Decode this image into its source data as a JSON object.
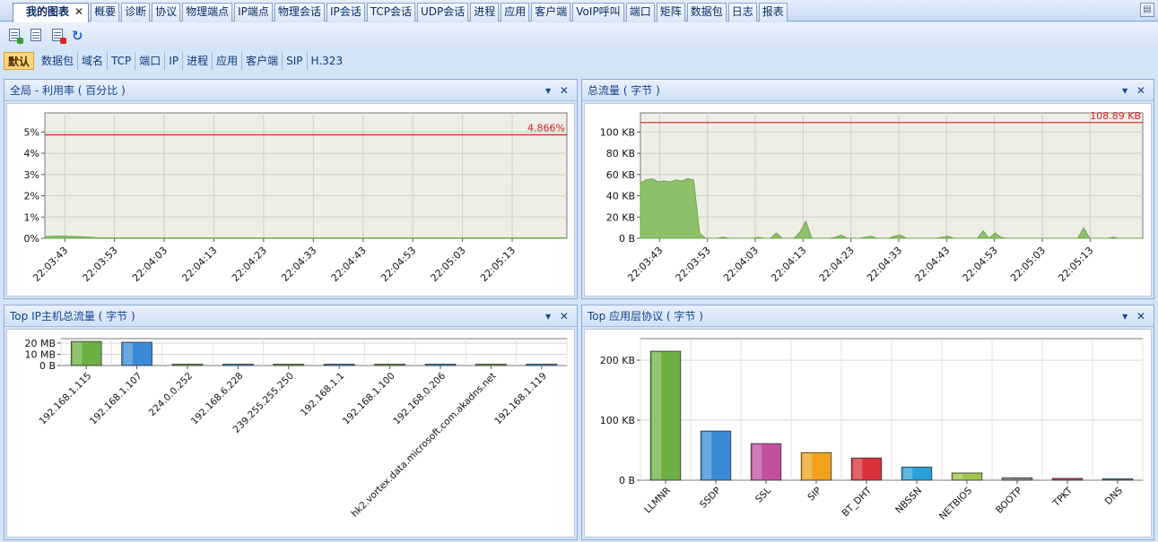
{
  "tabs": [
    {
      "label": "我的图表",
      "active": true
    },
    {
      "label": "概要"
    },
    {
      "label": "诊断"
    },
    {
      "label": "协议"
    },
    {
      "label": "物理端点"
    },
    {
      "label": "IP端点"
    },
    {
      "label": "物理会话"
    },
    {
      "label": "IP会话"
    },
    {
      "label": "TCP会话"
    },
    {
      "label": "UDP会话"
    },
    {
      "label": "进程"
    },
    {
      "label": "应用"
    },
    {
      "label": "客户端"
    },
    {
      "label": "VoIP呼叫"
    },
    {
      "label": "端口"
    },
    {
      "label": "矩阵"
    },
    {
      "label": "数据包"
    },
    {
      "label": "日志"
    },
    {
      "label": "报表"
    }
  ],
  "tab_close_glyph": "✕",
  "toolbar": {
    "icons": [
      "add-chart-icon",
      "edit-chart-icon",
      "delete-chart-icon",
      "refresh-icon"
    ],
    "refresh_glyph": "↻"
  },
  "filters": [
    "默认",
    "数据包",
    "域名",
    "TCP",
    "端口",
    "IP",
    "进程",
    "应用",
    "客户端",
    "SIP",
    "H.323"
  ],
  "panel_controls": "▾ ✕",
  "colors": {
    "threshold": "#cc2222",
    "area": "#8cc06a",
    "plot_bg": "#eeeee6"
  },
  "chart_data": [
    {
      "id": "utilization",
      "type": "area",
      "title": "全局 - 利用率 ( 百分比 )",
      "x": [
        "22:03:43",
        "22:03:53",
        "22:04:03",
        "22:04:13",
        "22:04:23",
        "22:04:33",
        "22:04:43",
        "22:04:53",
        "22:05:03",
        "22:05:13"
      ],
      "y_ticks": [
        "0%",
        "1%",
        "2%",
        "3%",
        "4%",
        "5%"
      ],
      "ylim": [
        0,
        5.9
      ],
      "values": [
        0.08,
        0.1,
        0.09,
        0.07,
        0.02,
        0.02,
        0.02,
        0.02,
        0.02,
        0.02,
        0.02,
        0.02,
        0.02,
        0.02,
        0.02,
        0.02,
        0.02,
        0.02,
        0.02,
        0.02,
        0.02,
        0.02,
        0.02,
        0.02,
        0.02,
        0.02,
        0.02,
        0.02,
        0.02,
        0.02,
        0.02,
        0.02,
        0.02,
        0.02,
        0.02,
        0.02,
        0.02,
        0.02,
        0.02,
        0.02
      ],
      "peak_value": 4.866,
      "peak_label": "4.866%",
      "grid": true
    },
    {
      "id": "total-traffic",
      "type": "area",
      "title": "总流量 ( 字节 )",
      "x": [
        "22:03:43",
        "22:03:53",
        "22:04:03",
        "22:04:13",
        "22:04:23",
        "22:04:33",
        "22:04:43",
        "22:04:53",
        "22:05:03",
        "22:05:13"
      ],
      "y_ticks": [
        "0 B",
        "20 KB",
        "40 KB",
        "60 KB",
        "80 KB",
        "100 KB"
      ],
      "ylim": [
        0,
        118
      ],
      "values": [
        52,
        55,
        56,
        53,
        54,
        53,
        55,
        54,
        56,
        55,
        5,
        0,
        0,
        0,
        1,
        0,
        0,
        0,
        0,
        0,
        1,
        0,
        0,
        5,
        0,
        0,
        0,
        6,
        16,
        0,
        0,
        0,
        0,
        1,
        3,
        0,
        0,
        0,
        1,
        2,
        0,
        0,
        0,
        2,
        3,
        0,
        0,
        0,
        0,
        0,
        0,
        1,
        2,
        0,
        0,
        0,
        0,
        0,
        7,
        0,
        5,
        1,
        0,
        0,
        0,
        0,
        0,
        0,
        0,
        0,
        0,
        0,
        0,
        0,
        0,
        10,
        0,
        0,
        0,
        0,
        1,
        0,
        0,
        0,
        0,
        0
      ],
      "peak_value": 108.89,
      "peak_label": "108.89 KB",
      "grid": true
    },
    {
      "id": "top-ip",
      "type": "bar",
      "title": "Top IP主机总流量 ( 字节 )",
      "categories": [
        "192.168.1.115",
        "192.168.1.107",
        "224.0.0.252",
        "192.168.6.228",
        "239.255.255.250",
        "192.168.1.1",
        "192.168.1.100",
        "192.168.0.206",
        "hk2.vortex.data.microsoft.com.akadns.net",
        "192.168.1.119"
      ],
      "values": [
        21.5,
        20.8,
        0.02,
        0.01,
        0.01,
        0.01,
        0.01,
        0.01,
        0.01,
        0.01
      ],
      "y_ticks": [
        "0 B",
        "10 MB",
        "20 MB"
      ],
      "ylim": [
        0,
        24
      ],
      "colors": [
        "#6cb044",
        "#3a8bd8"
      ],
      "grid": true
    },
    {
      "id": "top-app",
      "type": "bar",
      "title": "Top 应用层协议 ( 字节 )",
      "categories": [
        "LLMNR",
        "SSDP",
        "SSL",
        "SIP",
        "BT_DHT",
        "NBSSN",
        "NETBIOS",
        "BOOTP",
        "TPKT",
        "DNS"
      ],
      "values": [
        215,
        82,
        61,
        46,
        37,
        22,
        12,
        4,
        3,
        2
      ],
      "y_ticks": [
        "0 B",
        "100 KB",
        "200 KB"
      ],
      "ylim": [
        0,
        236
      ],
      "colors": [
        "#6cb044",
        "#3a8bd8",
        "#c2509e",
        "#f0a21e",
        "#d9303a",
        "#2aa0d8",
        "#9cc74a",
        "#888888",
        "#c23a6a",
        "#2a7fb8"
      ],
      "grid": true
    }
  ]
}
